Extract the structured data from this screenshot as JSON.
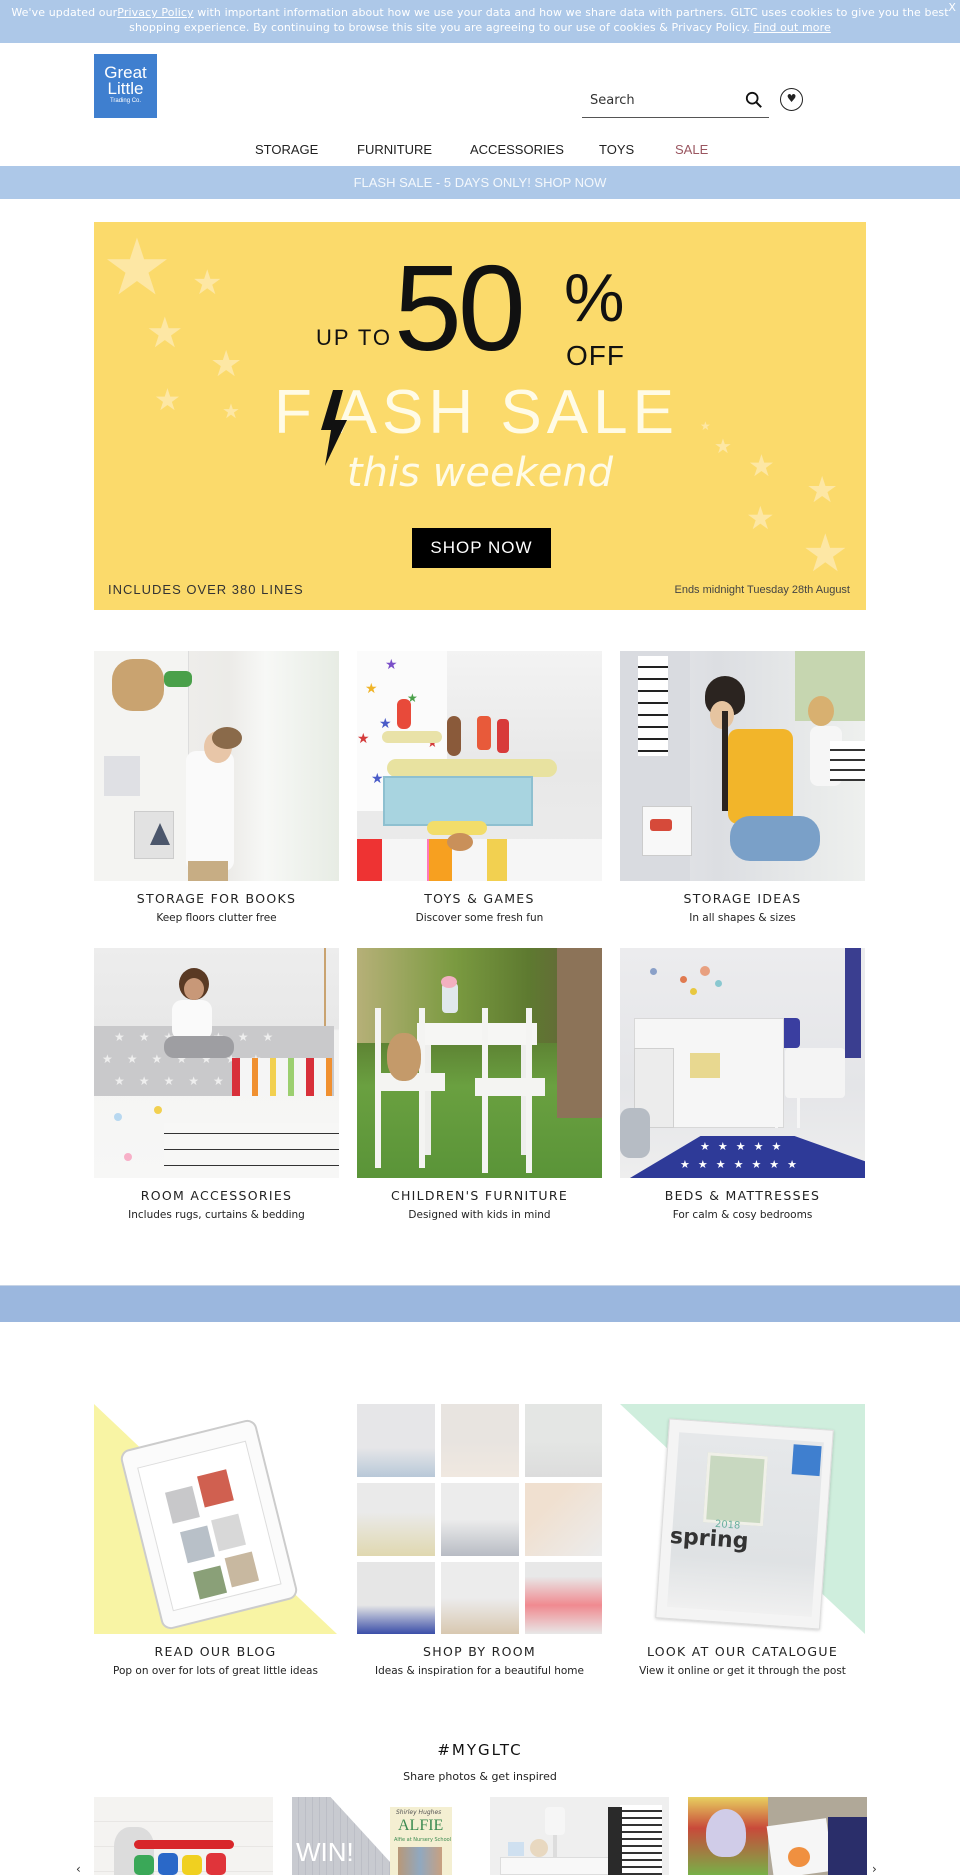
{
  "cookie": {
    "text_before": "We've updated our",
    "privacy_link": "Privacy Policy",
    "text_after": " with important information about how we use your data and how we share data with partners. GLTC uses cookies to give you the best shopping experience. By continuing to browse this site you are agreeing to our use of cookies & Privacy Policy. ",
    "find_out_more": "Find out more",
    "close_label": "X"
  },
  "header": {
    "logo": {
      "line1": "Great",
      "line2": "Little",
      "line3": "Trading Co."
    },
    "search": {
      "placeholder": "Search",
      "value": "",
      "icon": "search-icon"
    },
    "wishlist_icon": "heart-icon"
  },
  "nav": {
    "items": [
      {
        "label": "STORAGE"
      },
      {
        "label": "FURNITURE"
      },
      {
        "label": "ACCESSORIES"
      },
      {
        "label": "TOYS"
      },
      {
        "label": "SALE",
        "highlight": true
      }
    ]
  },
  "promo_bar": {
    "text": "FLASH SALE - 5 DAYS ONLY! SHOP NOW"
  },
  "hero": {
    "up_to": "UP TO",
    "percent_value": "50",
    "percent_sign": "%",
    "off": "OFF",
    "flash_sale": "F ASH SALE",
    "this_weekend": "this weekend",
    "cta": "SHOP NOW",
    "includes": "INCLUDES OVER 380 LINES",
    "ends": "Ends midnight Tuesday 28th August",
    "background_color": "#fbda6b"
  },
  "categories": [
    {
      "title": "STORAGE FOR BOOKS",
      "subtitle": "Keep floors clutter free"
    },
    {
      "title": "TOYS & GAMES",
      "subtitle": "Discover some fresh fun"
    },
    {
      "title": "STORAGE IDEAS",
      "subtitle": "In all shapes & sizes"
    },
    {
      "title": "ROOM ACCESSORIES",
      "subtitle": "Includes rugs, curtains & bedding"
    },
    {
      "title": "CHILDREN'S FURNITURE",
      "subtitle": "Designed with kids in mind"
    },
    {
      "title": "BEDS & MATTRESSES",
      "subtitle": "For calm & cosy bedrooms"
    }
  ],
  "features": [
    {
      "title": "READ OUR BLOG",
      "subtitle": "Pop on over for lots of great little ideas"
    },
    {
      "title": "SHOP BY ROOM",
      "subtitle": "Ideas & inspiration for a beautiful home"
    },
    {
      "title": "LOOK AT OUR CATALOGUE",
      "subtitle": "View it online or get it through the post",
      "catalogue_cover": {
        "season": "spring",
        "year": "2018"
      }
    }
  ],
  "instagram": {
    "title": "#MYGLTC",
    "subtitle": "Share photos & get inspired",
    "tiles": [
      {
        "alt": "paint caddy"
      },
      {
        "alt": "win alfie book",
        "overlay": "WIN!",
        "book_title": "ALFIE",
        "book_author": "Shirley Hughes",
        "book_subtitle": "Alfie at Nursery School"
      },
      {
        "alt": "bedroom dresser and clothes rail"
      },
      {
        "alt": "cat craft"
      }
    ],
    "prev_label": "‹",
    "next_label": "›"
  },
  "colors": {
    "brand_blue": "#3f7fcf",
    "cookie_bar": "#adc8e8",
    "band": "#9bb7de",
    "sale_text": "#9a5660"
  }
}
